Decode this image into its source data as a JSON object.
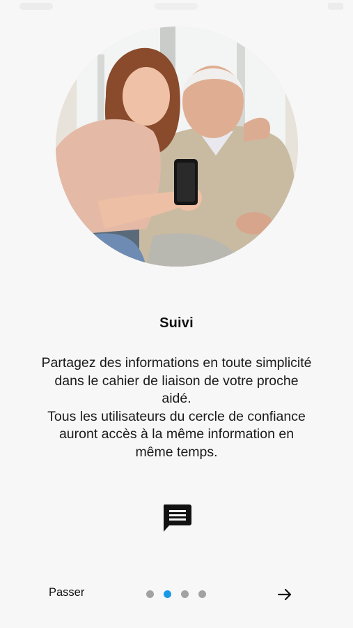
{
  "onboarding": {
    "title": "Suivi",
    "description_lines": [
      "Partagez des informations en toute simplicité",
      "dans le cahier de liaison de votre proche",
      "aidé.",
      "Tous les utilisateurs du cercle de confiance",
      "auront accès à la même information en",
      "même temps."
    ],
    "feature_icon": "chat-icon",
    "image_subject": "young woman and elderly man looking at a smartphone"
  },
  "footer": {
    "skip_label": "Passer",
    "pager": {
      "total": 4,
      "active_index": 1
    },
    "next_icon": "arrow-right-icon"
  },
  "colors": {
    "background": "#f7f7f7",
    "pager_active": "#1a9ae6",
    "pager_inactive": "#a2a2a2",
    "text": "#111111"
  }
}
